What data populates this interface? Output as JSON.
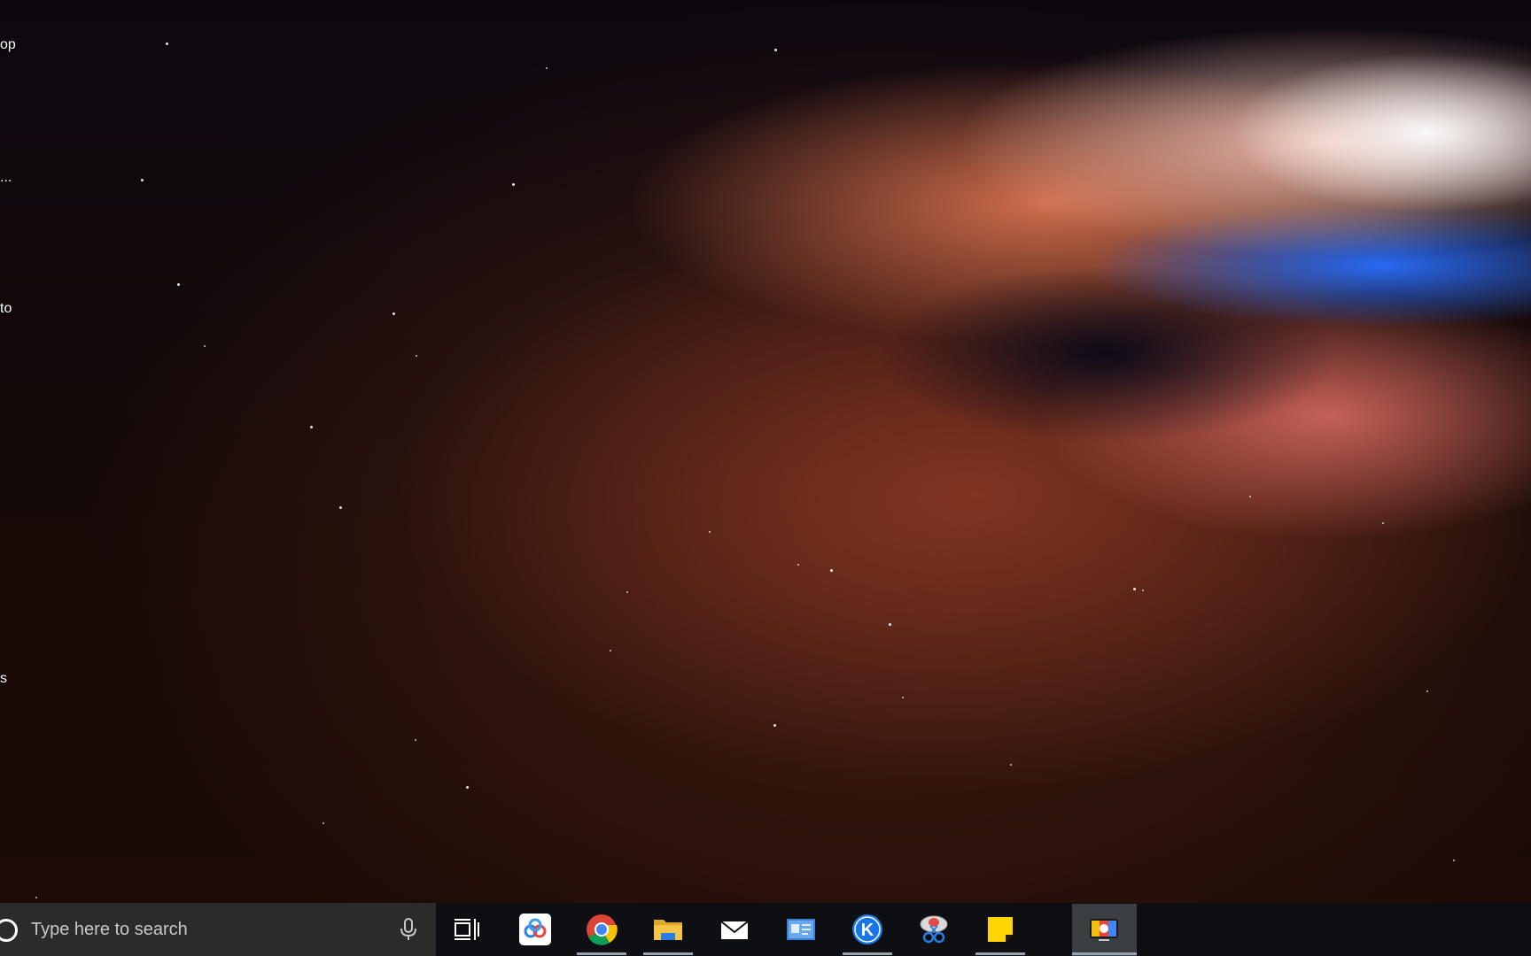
{
  "desktop": {
    "icon_labels": [
      "op",
      "...",
      "to",
      "s"
    ]
  },
  "taskbar": {
    "search": {
      "placeholder": "Type here to search",
      "icon": "search-circle-icon",
      "mic_icon": "microphone-icon"
    },
    "task_view_icon": "task-view-icon",
    "pinned": [
      {
        "name": "baidu-netdisk",
        "icon": "cloud-app-icon",
        "running": false
      },
      {
        "name": "google-chrome",
        "icon": "chrome-icon",
        "running": true
      },
      {
        "name": "file-explorer",
        "icon": "folder-icon",
        "running": true
      },
      {
        "name": "mail",
        "icon": "envelope-icon",
        "running": false
      },
      {
        "name": "contacts-card",
        "icon": "id-card-icon",
        "running": false
      },
      {
        "name": "k-app",
        "icon": "k-circle-icon",
        "running": true
      },
      {
        "name": "snipping-tool",
        "icon": "scissors-icon",
        "running": false
      },
      {
        "name": "sticky-notes",
        "icon": "sticky-note-icon",
        "running": true
      },
      {
        "name": "screen-recorder",
        "icon": "tv-app-icon",
        "running": true,
        "active": true
      }
    ]
  },
  "colors": {
    "taskbar_bg": "#0d0f12",
    "search_bg": "#2b2b2b",
    "chrome_red": "#db4437",
    "chrome_yellow": "#f4c20d",
    "chrome_green": "#0f9d58",
    "chrome_blue": "#4285f4",
    "folder_yellow": "#f6c547",
    "k_blue": "#1976e8",
    "sticky_yellow": "#ffd400"
  }
}
